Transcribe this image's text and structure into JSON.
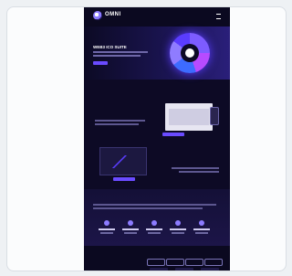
{
  "header": {
    "logo_text": "OMNI"
  },
  "hero": {
    "title": "WEB3 ICO SUITE"
  },
  "strip": {
    "items": [
      "",
      "",
      "",
      "",
      ""
    ]
  },
  "section1": {
    "title": ""
  },
  "section2": {
    "title": ""
  },
  "section3": {
    "title": ""
  },
  "colors": {
    "accent": "#6a4bff",
    "background": "#0d0a25",
    "card": "#fbfcfd"
  }
}
